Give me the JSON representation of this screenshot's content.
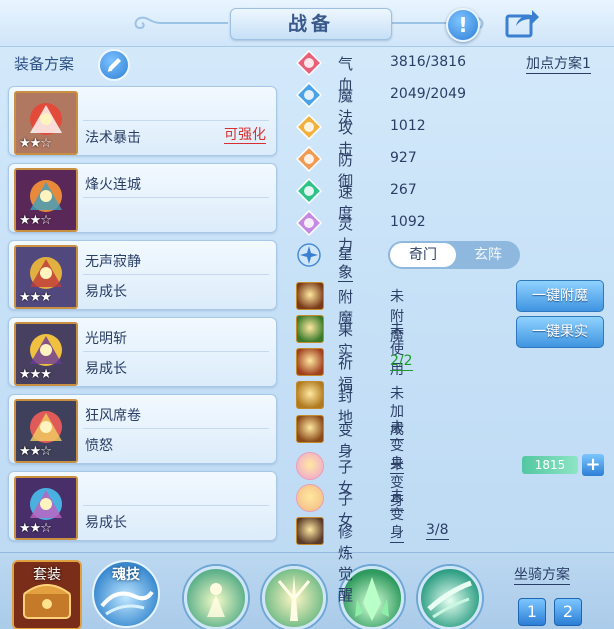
{
  "header": {
    "title": "战备",
    "warn_symbol": "!"
  },
  "left": {
    "plan_label": "装备方案",
    "equipment": [
      {
        "name": "",
        "sub": "法术暴击",
        "tag": "可强化",
        "stars": "★★☆"
      },
      {
        "name": "烽火连城",
        "sub": "",
        "tag": "",
        "stars": "★★☆"
      },
      {
        "name": "无声寂静",
        "sub": "易成长",
        "tag": "",
        "stars": "★★★"
      },
      {
        "name": "光明斩",
        "sub": "易成长",
        "tag": "",
        "stars": "★★★"
      },
      {
        "name": "狂风席卷",
        "sub": "愤怒",
        "tag": "",
        "stars": "★★☆"
      },
      {
        "name": "",
        "sub": "易成长",
        "tag": "",
        "stars": "★★☆"
      }
    ]
  },
  "stats": [
    {
      "label": "气血",
      "value": "3816/3816",
      "icon": "heart-icon",
      "color": "#e8607a"
    },
    {
      "label": "魔法",
      "value": "2049/2049",
      "icon": "mana-icon",
      "color": "#4aa2e8"
    },
    {
      "label": "攻击",
      "value": "1012",
      "icon": "attack-icon",
      "color": "#f2b13c"
    },
    {
      "label": "防御",
      "value": "927",
      "icon": "defense-icon",
      "color": "#f09a52"
    },
    {
      "label": "速度",
      "value": "267",
      "icon": "speed-icon",
      "color": "#2fc38a"
    },
    {
      "label": "灵力",
      "value": "1092",
      "icon": "spirit-icon",
      "color": "#c58ae0"
    }
  ],
  "add_plan": "加点方案1",
  "star": {
    "label": "星象",
    "options": [
      "奇门",
      "玄阵"
    ]
  },
  "buffs": [
    {
      "label": "附魔",
      "value": "未附魔",
      "style": ""
    },
    {
      "label": "果实",
      "value": "未使用",
      "style": ""
    },
    {
      "label": "祈福",
      "value": "2/2",
      "style": "g"
    },
    {
      "label": "封地",
      "value": "未加成",
      "style": "u"
    },
    {
      "label": "变身",
      "value": "未变身",
      "style": "u"
    },
    {
      "label": "子女",
      "value": "未变身",
      "style": "u"
    },
    {
      "label": "子女",
      "value": "未变身",
      "style": "u"
    },
    {
      "label": "修炼觉醒",
      "value": "3/8",
      "style": "u"
    }
  ],
  "buttons": {
    "enchant": "一键附魔",
    "fruit": "一键果实"
  },
  "xp": {
    "value": "1815",
    "plus": "+"
  },
  "bottom": {
    "set_label": "套装",
    "soul_label": "魂技",
    "mount_label": "坐骑方案",
    "mount_nums": [
      "1",
      "2"
    ]
  }
}
